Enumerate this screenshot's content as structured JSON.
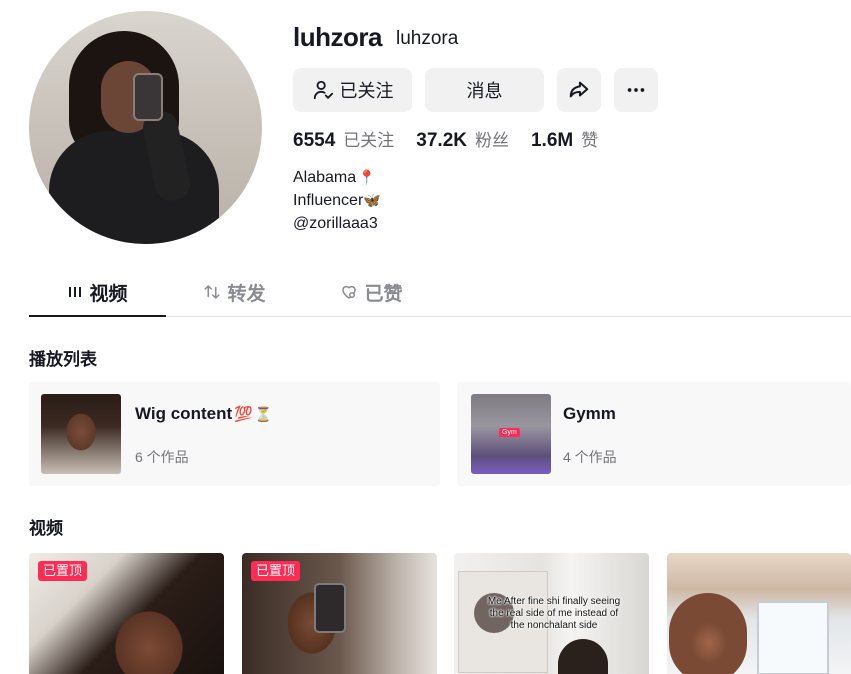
{
  "profile": {
    "username": "luhzora",
    "nickname": "luhzora"
  },
  "actions": {
    "follow_label": "已关注",
    "message_label": "消息",
    "share_icon": "share-arrow-icon",
    "more_icon": "more-dots-icon"
  },
  "stats": {
    "following_count": "6554",
    "following_label": "已关注",
    "followers_count": "37.2K",
    "followers_label": "粉丝",
    "likes_count": "1.6M",
    "likes_label": "赞"
  },
  "bio": {
    "line1": "Alabama",
    "line1_emoji": "📍",
    "line2": "Influencer",
    "line2_emoji": "🦋",
    "line3": "@zorillaaa3"
  },
  "tabs": [
    {
      "label": "视频",
      "icon": "grid-icon",
      "active": true
    },
    {
      "label": "转发",
      "icon": "repost-icon",
      "active": false
    },
    {
      "label": "已赞",
      "icon": "heart-hidden-icon",
      "active": false
    }
  ],
  "playlists": {
    "title": "播放列表",
    "items": [
      {
        "name": "Wig content",
        "emoji": "💯",
        "emoji2": "⏳",
        "count": "6 个作品"
      },
      {
        "name": "Gymm",
        "count": "4 个作品",
        "thumb_tag": "Gym"
      }
    ]
  },
  "videos": {
    "title": "视频",
    "items": [
      {
        "pinned_label": "已置顶"
      },
      {
        "pinned_label": "已置顶"
      },
      {
        "caption": "Me After fine shi finally seeing the real side of me instead of the nonchalant side"
      },
      {}
    ]
  },
  "colors": {
    "accent": "#fe2c55",
    "text_primary": "#161823",
    "text_secondary": "#73747b",
    "button_bg": "#f1f1f2"
  }
}
